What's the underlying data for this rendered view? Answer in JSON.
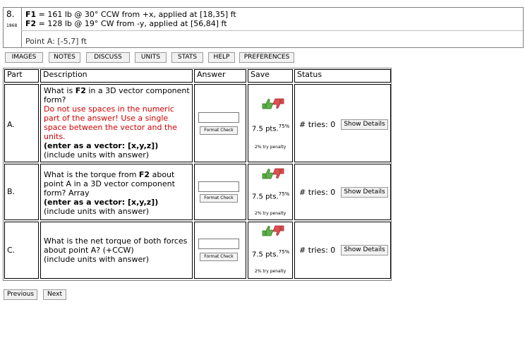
{
  "problem": {
    "number": "8.",
    "id": "1868",
    "force1_label": "F1",
    "force1_text": " = 161 lb @ 30° CCW from +x, applied at [18,35] ft",
    "force2_label": "F2",
    "force2_text": " = 128 lb @ 19° CW from -y, applied at [56,84] ft",
    "point_a": "Point A: [-5,7] ft"
  },
  "toolbar": {
    "images": "IMAGES",
    "notes": "NOTES",
    "discuss": "DISCUSS",
    "units": "UNITS",
    "stats": "STATS",
    "help": "HELP",
    "preferences": "PREFERENCES"
  },
  "table": {
    "headers": {
      "part": "Part",
      "description": "Description",
      "answer": "Answer",
      "save": "Save",
      "status": "Status"
    },
    "rows": [
      {
        "part": "A.",
        "q1": "What is ",
        "q_bold": "F2",
        "q2": " in a 3D vector component form?",
        "red_note": "Do not use spaces in the numeric part of the answer! Use a single space between the vector and the units.",
        "hint_bold": "(enter as a vector: [x,y,z])",
        "hint": "(include units with answer)",
        "answer_value": "",
        "format_check": "Format Check",
        "points": "7.5 pts.",
        "percent": "75%",
        "penalty": "2% try penalty",
        "tries": "# tries: 0",
        "show_details": "Show Details"
      },
      {
        "part": "B.",
        "q1": "What is the torque from ",
        "q_bold": "F2",
        "q2": " about point A in a 3D vector component form? Array",
        "hint_bold": "(enter as a vector: [x,y,z])",
        "hint": "(include units with answer)",
        "answer_value": "",
        "format_check": "Format Check",
        "points": "7.5 pts.",
        "percent": "75%",
        "penalty": "2% try penalty",
        "tries": "# tries: 0",
        "show_details": "Show Details"
      },
      {
        "part": "C.",
        "q1": "What is the net torque of both forces about point A? (+CCW)",
        "hint": "(include units with answer)",
        "answer_value": "",
        "format_check": "Format Check",
        "points": "7.5 pts.",
        "percent": "75%",
        "penalty": "2% try penalty",
        "tries": "# tries: 0",
        "show_details": "Show Details"
      }
    ]
  },
  "footer": {
    "previous": "Previous",
    "next": "Next"
  },
  "colors": {
    "red_text": "#d00000",
    "thumb_up": "#3a9a2a",
    "thumb_down": "#d03030"
  }
}
